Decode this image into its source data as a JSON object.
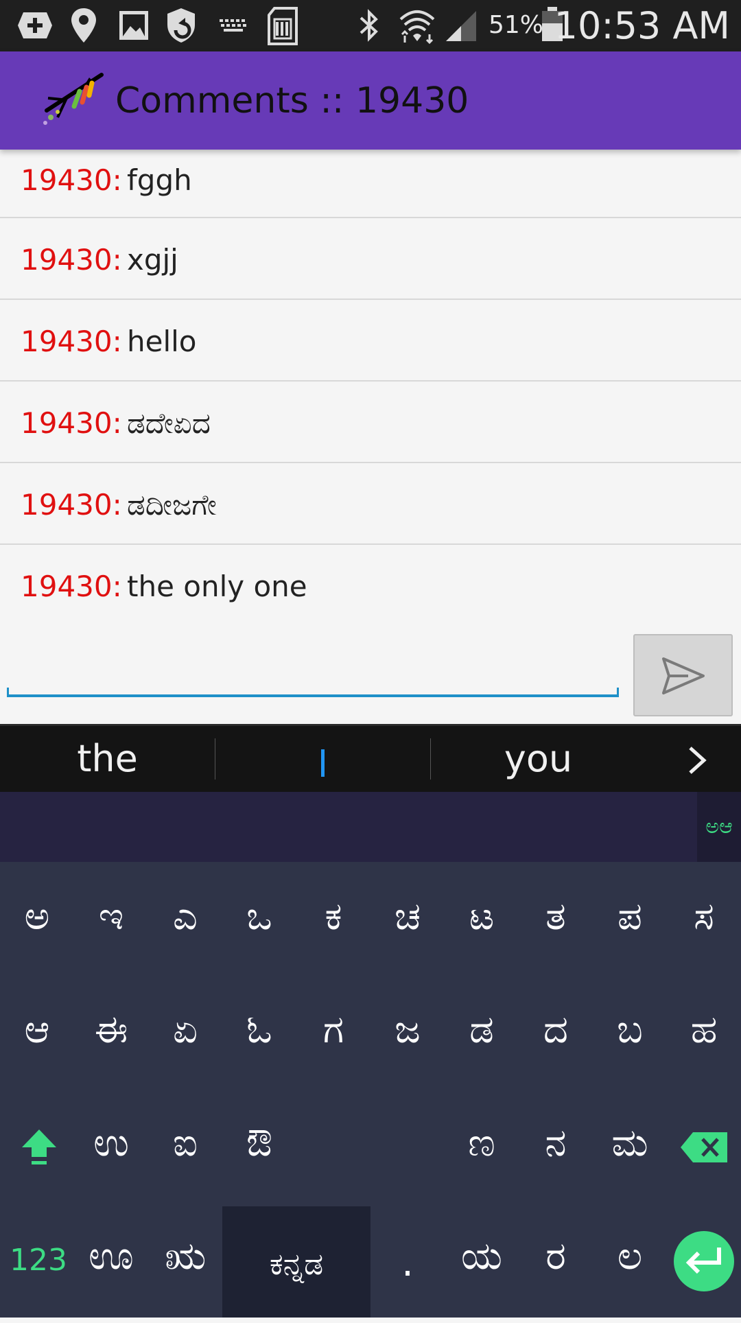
{
  "status_bar": {
    "battery_percent": "51%",
    "time": "10:53 AM"
  },
  "app_bar": {
    "title": "Comments :: 19430"
  },
  "comments": [
    {
      "id": "19430:",
      "text": "fggh"
    },
    {
      "id": "19430:",
      "text": "xgjj"
    },
    {
      "id": "19430:",
      "text": "hello"
    },
    {
      "id": "19430:",
      "text": "ಡದೇಏದ"
    },
    {
      "id": "19430:",
      "text": "ಡದೀಜಗೇ"
    },
    {
      "id": "19430:",
      "text": "the only one"
    }
  ],
  "compose": {
    "input_value": "",
    "send_icon": "send-icon"
  },
  "suggestions": [
    "the",
    "I",
    "you"
  ],
  "keyboard": {
    "lang_toggle": "ಅಆ",
    "row1": [
      "ಅ",
      "ಇ",
      "ಎ",
      "ಒ",
      "ಕ",
      "ಚ",
      "ಟ",
      "ತ",
      "ಪ",
      "ಸ"
    ],
    "row2": [
      "ಆ",
      "ಈ",
      "ಏ",
      "ಓ",
      "ಗ",
      "ಜ",
      "ಡ",
      "ದ",
      "ಬ",
      "ಹ"
    ],
    "row3": [
      "ಉ",
      "ಐ",
      "ಔ",
      "ಣ",
      "ನ",
      "ಮ"
    ],
    "row4_left": [
      "ಊ",
      "ಋ"
    ],
    "space_label": "ಕನ್ನಡ",
    "period": ".",
    "row4_right": [
      "ಯ",
      "ರ",
      "ಲ"
    ],
    "numbers_label": "123"
  },
  "colors": {
    "app_bar": "#673ab7",
    "comment_id": "#e01010",
    "accent_green": "#3ddc84",
    "input_underline": "#1e90c8"
  }
}
